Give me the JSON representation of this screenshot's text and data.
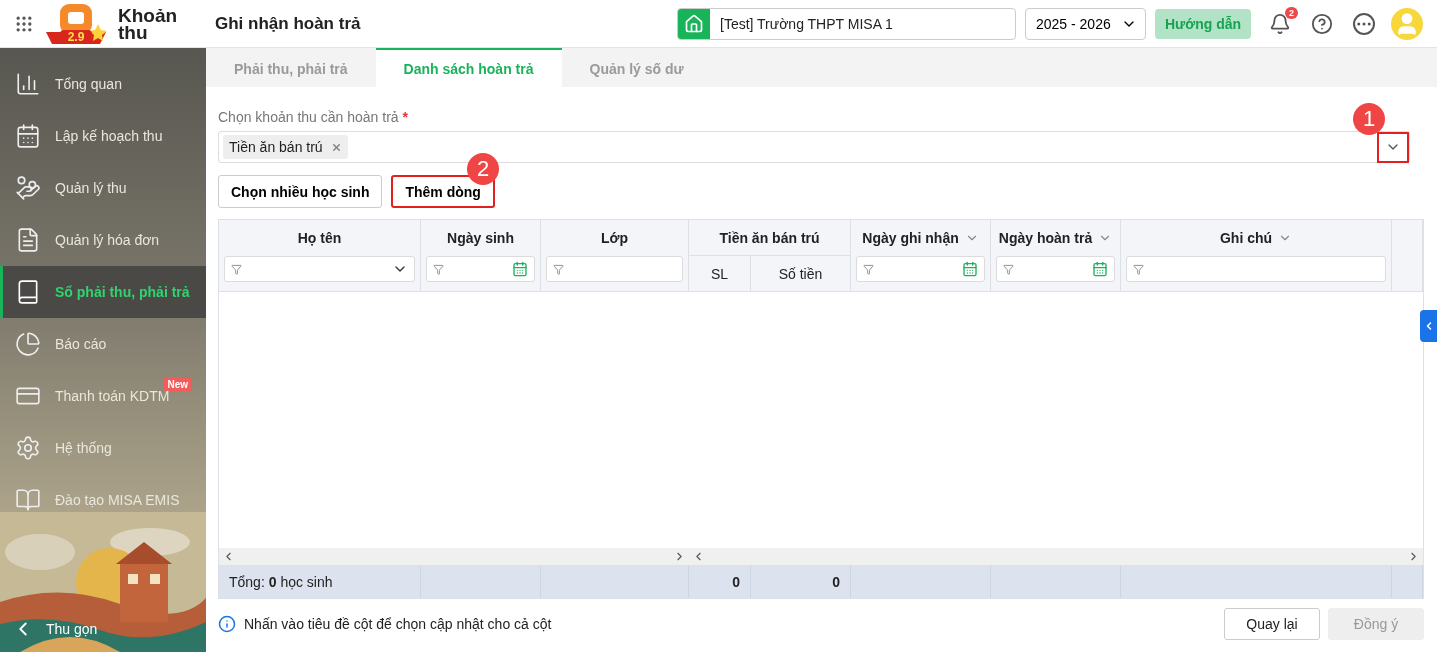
{
  "app": {
    "name": "Khoản thu",
    "logo_text": "2.9"
  },
  "page_title": "Ghi nhận hoàn trả",
  "school": "[Test] Trường THPT MISA 1",
  "school_year": "2025 - 2026",
  "guide_button": "Hướng dẫn",
  "notification_count": "2",
  "sidebar": {
    "items": [
      {
        "label": "Tổng quan",
        "selected": false
      },
      {
        "label": "Lập kế hoạch thu",
        "selected": false
      },
      {
        "label": "Quản lý thu",
        "selected": false
      },
      {
        "label": "Quản lý hóa đơn",
        "selected": false
      },
      {
        "label": "Sổ phải thu, phải trả",
        "selected": true
      },
      {
        "label": "Báo cáo",
        "selected": false
      },
      {
        "label": "Thanh toán KDTM",
        "selected": false,
        "badge": "New"
      },
      {
        "label": "Hệ thống",
        "selected": false
      },
      {
        "label": "Đào tạo MISA EMIS",
        "selected": false
      }
    ],
    "collapse": "Thu gọn"
  },
  "tabs": [
    {
      "label": "Phải thu, phải trả",
      "selected": false
    },
    {
      "label": "Danh sách hoàn trả",
      "selected": true
    },
    {
      "label": "Quản lý số dư",
      "selected": false
    }
  ],
  "fee_select": {
    "label": "Chọn khoản thu cần hoàn trả",
    "required_mark": "*",
    "chips": [
      "Tiền ăn bán trú"
    ],
    "annotation": "1"
  },
  "buttons": [
    {
      "label": "Chọn nhiều học sinh"
    },
    {
      "label": "Thêm dòng",
      "annotation": "2"
    }
  ],
  "table": {
    "left_columns": [
      {
        "title": "Họ tên",
        "kind": "dropdown-filter"
      },
      {
        "title": "Ngày sinh",
        "kind": "date-filter"
      },
      {
        "title": "Lớp",
        "kind": "text-filter"
      }
    ],
    "right_columns": [
      {
        "kind": "group",
        "title": "Tiền ăn bán trú",
        "subcolumns": [
          "SL",
          "Số tiền"
        ]
      },
      {
        "kind": "date-filter",
        "title": "Ngày ghi nhận",
        "sortable": true
      },
      {
        "kind": "date-filter",
        "title": "Ngày hoàn trả",
        "sortable": true
      },
      {
        "kind": "text-filter",
        "title": "Ghi chú",
        "sortable": true
      }
    ],
    "footer_total": "Tổng: **0** học sinh",
    "footer_values": [
      "0",
      "0"
    ]
  },
  "hint": "Nhấn vào tiêu đề cột để chọn cập nhật cho cả cột",
  "actions": [
    {
      "label": "Quay lại",
      "disabled": false
    },
    {
      "label": "Đồng ý",
      "disabled": true
    }
  ]
}
